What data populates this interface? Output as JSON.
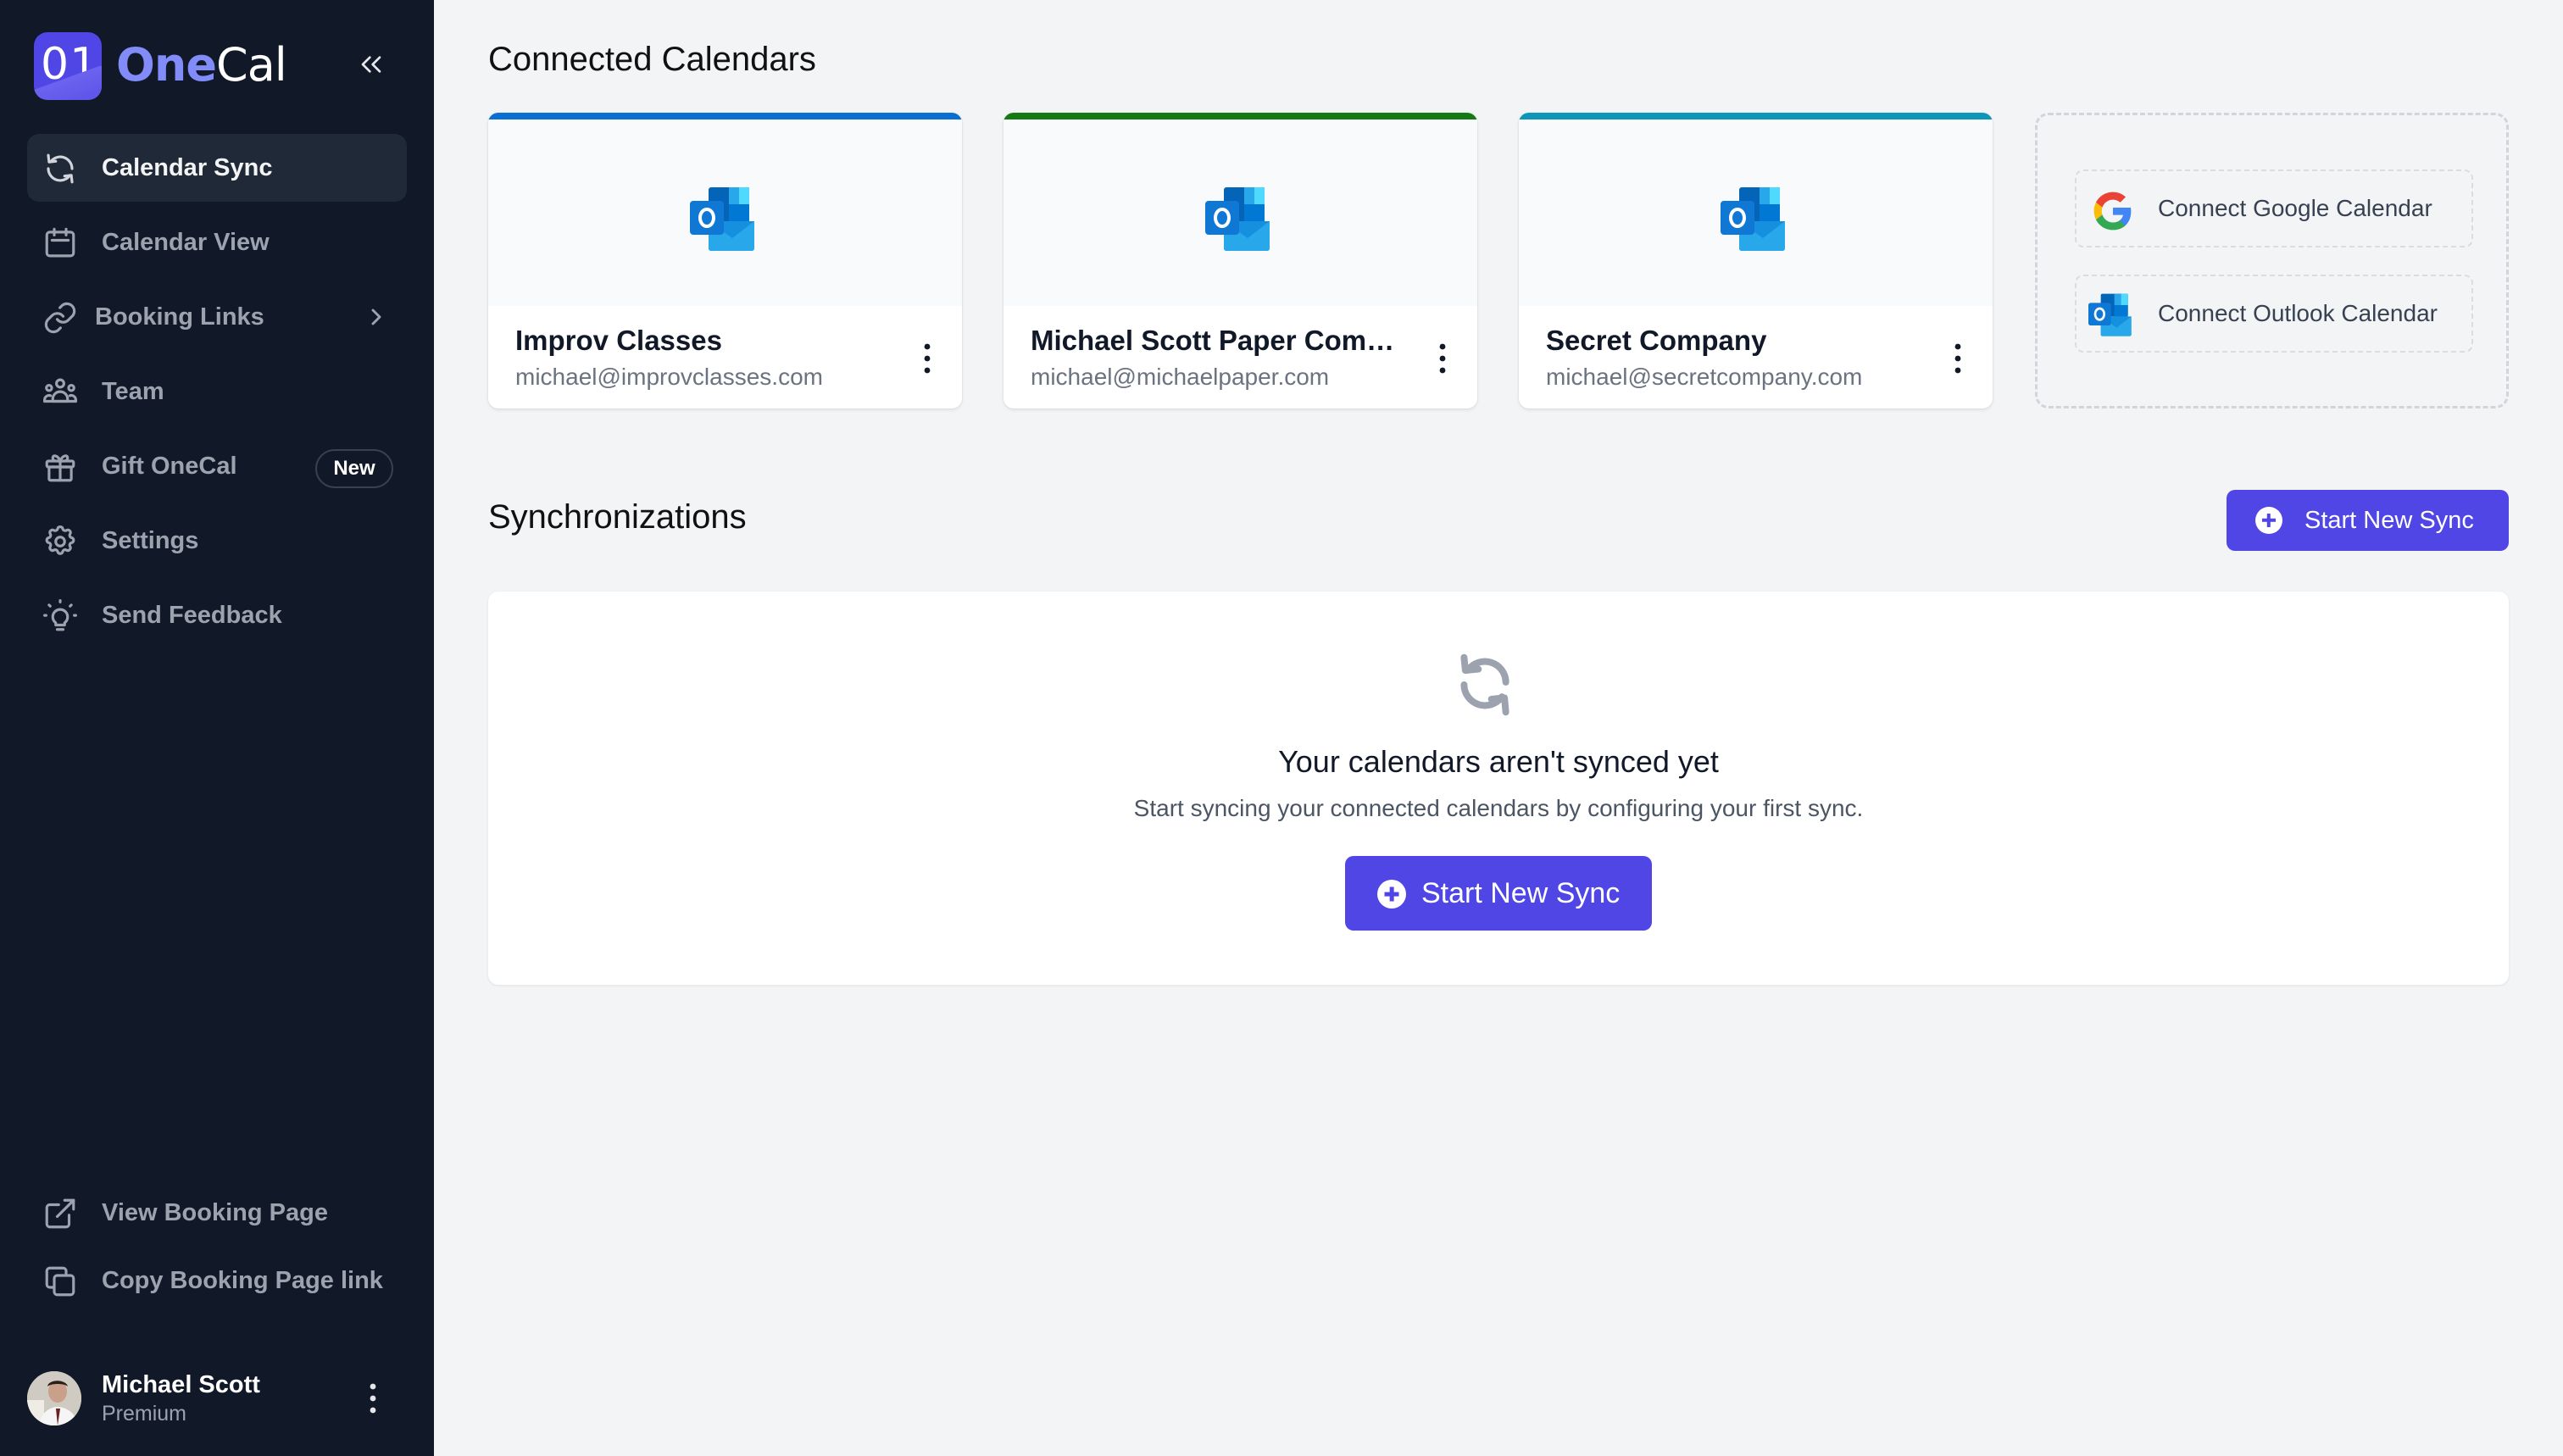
{
  "app": {
    "logo_text": "01",
    "brand_part1": "One",
    "brand_part2": "Cal"
  },
  "sidebar": {
    "nav": [
      {
        "id": "calendar-sync",
        "label": "Calendar Sync",
        "icon": "sync-icon",
        "active": true
      },
      {
        "id": "calendar-view",
        "label": "Calendar View",
        "icon": "calendar-icon"
      },
      {
        "id": "booking-links",
        "label": "Booking Links",
        "icon": "link-icon",
        "has_submenu": true
      },
      {
        "id": "team",
        "label": "Team",
        "icon": "team-icon"
      },
      {
        "id": "gift-onecal",
        "label": "Gift OneCal",
        "icon": "gift-icon",
        "badge": "New"
      },
      {
        "id": "settings",
        "label": "Settings",
        "icon": "gear-icon"
      },
      {
        "id": "send-feedback",
        "label": "Send Feedback",
        "icon": "lightbulb-icon"
      }
    ],
    "footer_links": [
      {
        "id": "view-booking-page",
        "label": "View Booking Page",
        "icon": "external-link-icon"
      },
      {
        "id": "copy-booking-link",
        "label": "Copy Booking Page link",
        "icon": "copy-icon"
      }
    ],
    "user": {
      "name": "Michael Scott",
      "plan": "Premium"
    }
  },
  "main": {
    "connected_title": "Connected Calendars",
    "calendars": [
      {
        "name": "Improv Classes",
        "email": "michael@improvclasses.com",
        "provider": "outlook",
        "color": "#0a6fd0"
      },
      {
        "name": "Michael Scott Paper Company",
        "email": "michael@michaelpaper.com",
        "provider": "outlook",
        "color": "#157a13"
      },
      {
        "name": "Secret Company",
        "email": "michael@secretcompany.com",
        "provider": "outlook",
        "color": "#0e96b8"
      }
    ],
    "connect": {
      "google_label": "Connect Google Calendar",
      "outlook_label": "Connect Outlook Calendar"
    },
    "sync_title": "Synchronizations",
    "start_sync_label": "Start New Sync",
    "empty_state": {
      "title": "Your calendars aren't synced yet",
      "description": "Start syncing your connected calendars by configuring your first sync.",
      "button_label": "Start New Sync"
    }
  },
  "colors": {
    "sidebar_bg": "#111827",
    "accent": "#4f46e5",
    "brand_light": "#818cf8"
  }
}
